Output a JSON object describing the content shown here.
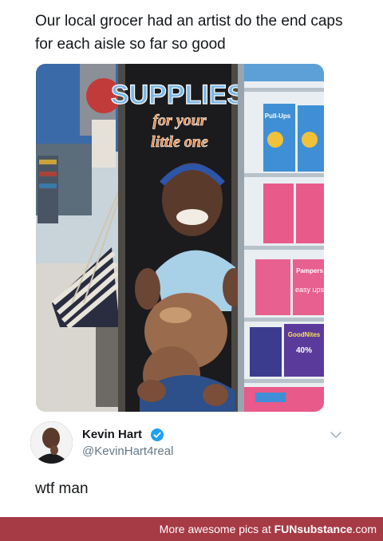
{
  "post": {
    "caption": "Our local grocer had an artist do the end caps for each aisle so far so good",
    "photo": {
      "sign_line1": "SUPPLIES",
      "sign_line2": "for your",
      "sign_line3": "little one",
      "shelf_brand_1": "Pampers",
      "shelf_brand_2": "Pull-Ups",
      "shelf_brand_3": "GoodNites",
      "shelf_text_easy_ups": "easy ups",
      "shelf_percent": "40%"
    }
  },
  "reply": {
    "author_name": "Kevin Hart",
    "author_handle": "@KevinHart4real",
    "text": "wtf man",
    "verified_color": "#1da1f2"
  },
  "footer": {
    "prefix": "More awesome pics at ",
    "brand_bold": "FUN",
    "brand_rest": "substance",
    "brand_suffix": ".com",
    "background": "#a63a45"
  }
}
